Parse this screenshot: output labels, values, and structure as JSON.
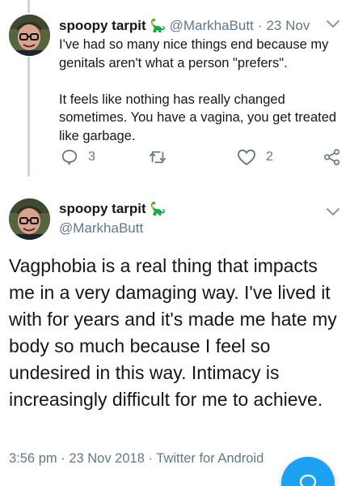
{
  "tweet1": {
    "display_name": "spoopy tarpit",
    "emoji": "🦕",
    "handle": "@MarkhaButt",
    "separator": "·",
    "date": "23 Nov",
    "paragraph1": "I've had so many nice things end because my genitals aren't what a person \"prefers\".",
    "paragraph2": "It feels like nothing has really changed sometimes. You have a vagina, you get treated like garbage.",
    "reply_count": "3",
    "retweet_count": "",
    "like_count": "2"
  },
  "tweet2": {
    "display_name": "spoopy tarpit",
    "emoji": "🦕",
    "handle": "@MarkhaButt",
    "body": "Vagphobia is a real thing that impacts me in a very damaging way. I've lived it with for years and it's made me hate my body so much because I feel so undesired in this way. Intimacy is increasingly difficult for me to achieve.",
    "time": "3:56 pm",
    "date": "23 Nov 2018",
    "client": "Twitter for Android",
    "meta_separator": "·"
  },
  "colors": {
    "accent": "#1da1f2",
    "secondary_text": "#657786",
    "thread_line": "#ccd6dd"
  },
  "icons": [
    "reply-icon",
    "retweet-icon",
    "heart-icon",
    "share-icon",
    "chevron-down-icon",
    "compose-icon"
  ]
}
